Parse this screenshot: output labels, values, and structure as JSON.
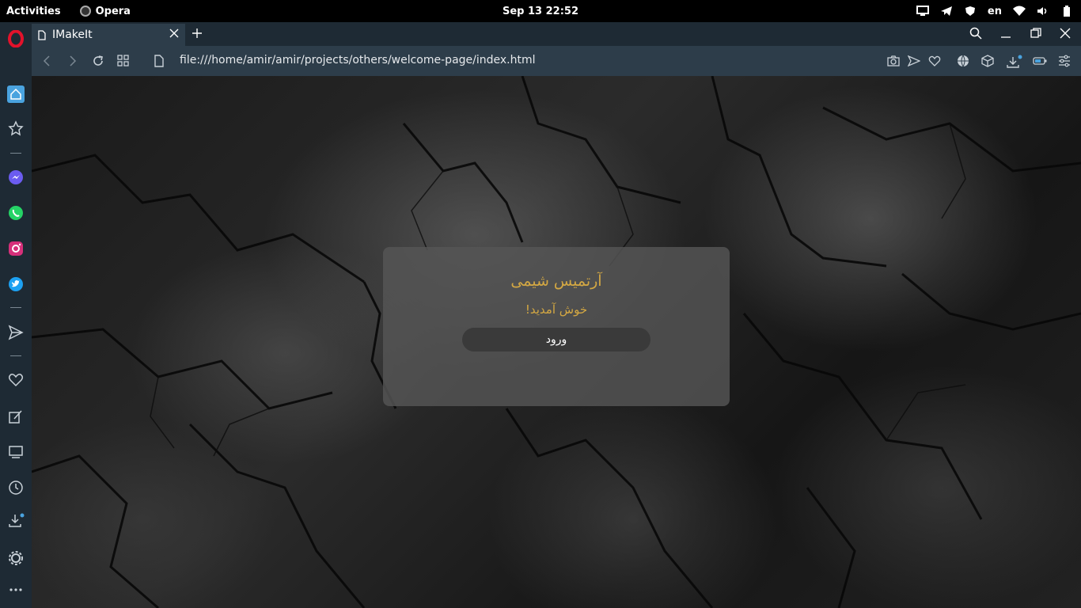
{
  "system": {
    "activities": "Activities",
    "app_name": "Opera",
    "clock": "Sep 13  22:52",
    "language": "en"
  },
  "browser": {
    "tab_title": "IMakeIt",
    "url": "file:///home/amir/amir/projects/others/welcome-page/index.html"
  },
  "page": {
    "name": "آرتمیس شیمی",
    "welcome": "خوش آمدید!",
    "login_label": "ورود"
  },
  "colors": {
    "accent_text": "#d4a843",
    "sidebar_bg": "#1e2a34",
    "toolbar_bg": "#2d3d4a",
    "opera_red": "#e3122b"
  }
}
